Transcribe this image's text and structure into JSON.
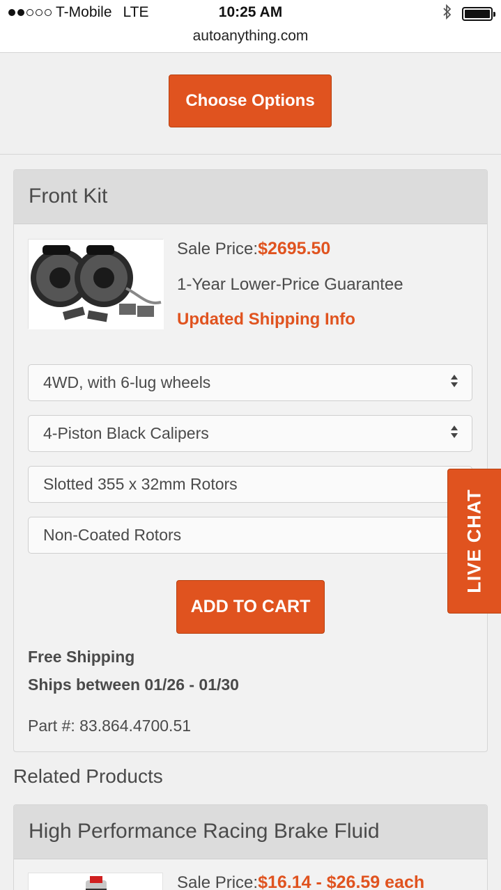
{
  "status_bar": {
    "carrier": "T-Mobile",
    "network": "LTE",
    "time": "10:25 AM",
    "url": "autoanything.com",
    "signal_bars_filled": 2,
    "signal_bars_total": 5
  },
  "top": {
    "choose_options_label": "Choose Options"
  },
  "product": {
    "title": "Front Kit",
    "sale_price_label": "Sale Price:",
    "sale_price": "$2695.50",
    "guarantee": "1-Year Lower-Price Guarantee",
    "shipping_info_link": "Updated Shipping Info",
    "options": [
      "4WD, with 6-lug wheels",
      "4-Piston Black Calipers",
      "Slotted 355 x 32mm Rotors",
      "Non-Coated Rotors"
    ],
    "add_to_cart_label": "ADD TO CART",
    "free_shipping": "Free Shipping",
    "ships_between": "Ships between 01/26 - 01/30",
    "part_number": "Part #: 83.864.4700.51"
  },
  "live_chat_label": "LIVE CHAT",
  "related": {
    "title": "Related Products",
    "items": [
      {
        "title": "High Performance Racing Brake Fluid",
        "sale_price_label": "Sale Price:",
        "sale_price": "$16.14 - $26.59 each"
      }
    ]
  },
  "colors": {
    "accent": "#e0531f",
    "background": "#f0f0f0",
    "card_header": "#dcdcdc"
  }
}
